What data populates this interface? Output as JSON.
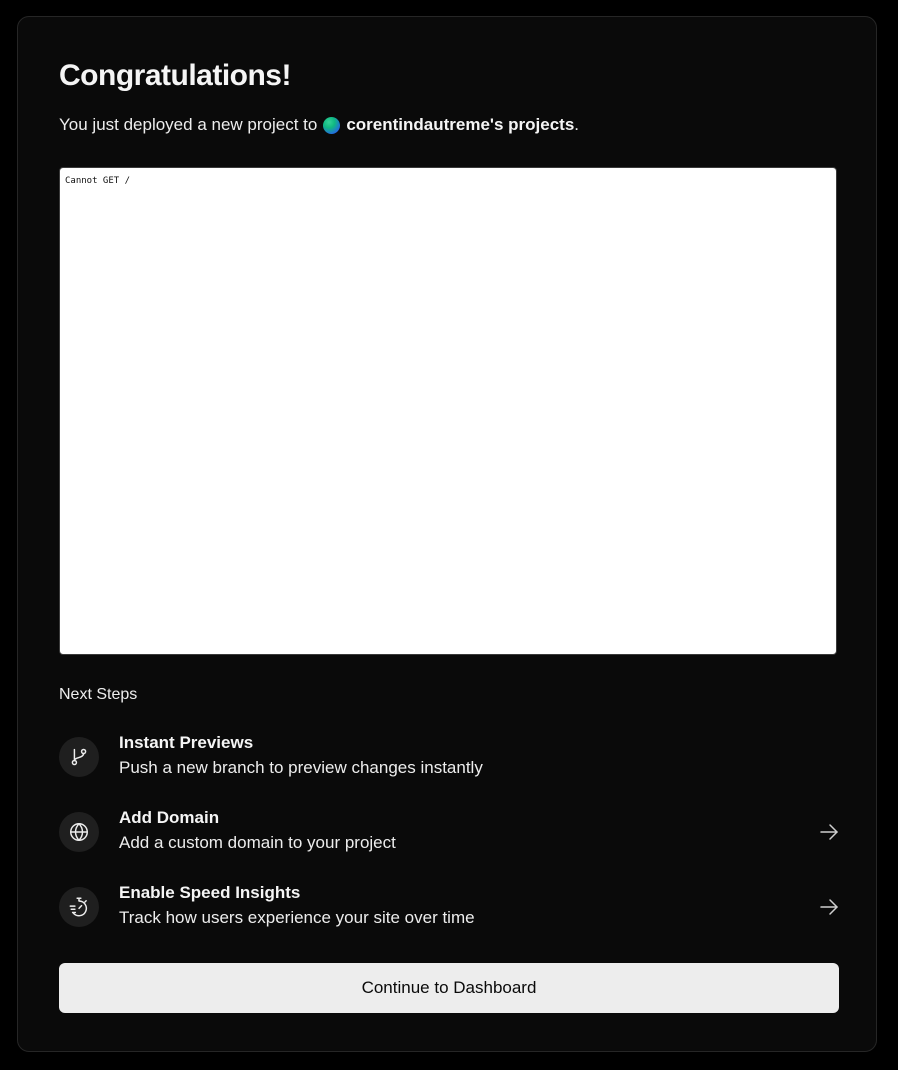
{
  "header": {
    "title": "Congratulations!",
    "subtitle_prefix": "You just deployed a new project to",
    "team_name": "corentindautreme's projects",
    "subtitle_suffix": "."
  },
  "preview": {
    "text": "Cannot GET /"
  },
  "next_steps": {
    "heading": "Next Steps",
    "items": [
      {
        "icon": "git-branch-icon",
        "title": "Instant Previews",
        "description": "Push a new branch to preview changes instantly",
        "has_arrow": false
      },
      {
        "icon": "globe-icon",
        "title": "Add Domain",
        "description": "Add a custom domain to your project",
        "has_arrow": true
      },
      {
        "icon": "speed-timer-icon",
        "title": "Enable Speed Insights",
        "description": "Track how users experience your site over time",
        "has_arrow": true
      }
    ]
  },
  "actions": {
    "continue_label": "Continue to Dashboard"
  },
  "colors": {
    "page_background": "#000000",
    "card_background": "#0a0a0a",
    "card_border": "#262626",
    "icon_circle": "#1f1f1f",
    "button_background": "#ededed",
    "button_text": "#0a0a0a",
    "text_primary": "#ededed"
  }
}
